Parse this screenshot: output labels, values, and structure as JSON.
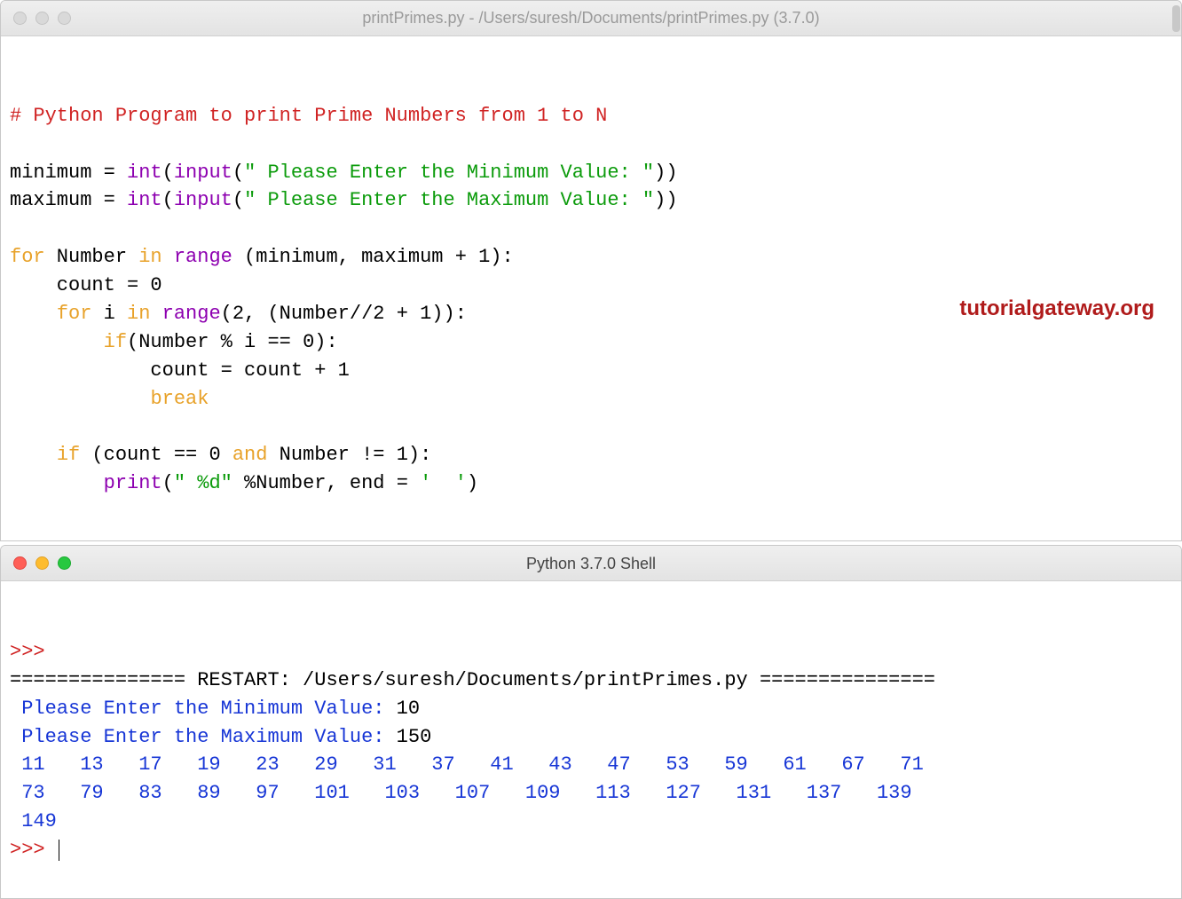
{
  "editor": {
    "title": "printPrimes.py - /Users/suresh/Documents/printPrimes.py (3.7.0)",
    "watermark": "tutorialgateway.org",
    "code": {
      "l1_comment": "# Python Program to print Prime Numbers from 1 to N",
      "l3_minimum": "minimum = ",
      "l3_int": "int",
      "l3_input": "input",
      "l3_str": "\" Please Enter the Minimum Value: \"",
      "l4_maximum": "maximum = ",
      "l4_str": "\" Please Enter the Maximum Value: \"",
      "l6_for": "for",
      "l6_name": " Number ",
      "l6_in": "in",
      "l6_range": "range",
      "l6_tail": " (minimum, maximum + 1):",
      "l7_count": "    count = 0",
      "l8_for": "for",
      "l8_i": " i ",
      "l8_in": "in",
      "l8_range": "range",
      "l8_tail": "(2, (Number//2 + 1)):",
      "l9_if": "if",
      "l9_tail": "(Number % i == 0):",
      "l10_count": "            count = count + 1",
      "l11_break": "break",
      "l13_if": "if",
      "l13_mid": " (count == 0 ",
      "l13_and": "and",
      "l13_tail": " Number != 1):",
      "l14_print": "print",
      "l14_open": "(",
      "l14_str1": "\" %d\"",
      "l14_mid": " %Number, end = ",
      "l14_str2": "'  '",
      "l14_close": ")"
    }
  },
  "shell": {
    "title": "Python 3.7.0 Shell",
    "prompt": ">>>",
    "restart_bar": "=============== RESTART: /Users/suresh/Documents/printPrimes.py ===============",
    "min_prompt": " Please Enter the Minimum Value: ",
    "min_value": "10",
    "max_prompt": " Please Enter the Maximum Value: ",
    "max_value": "150",
    "primes_line1": " 11   13   17   19   23   29   31   37   41   43   47   53   59   61   67   71",
    "primes_line2": " 73   79   83   89   97   101   103   107   109   113   127   131   137   139",
    "primes_line3": " 149",
    "final_prompt": ">>> "
  }
}
